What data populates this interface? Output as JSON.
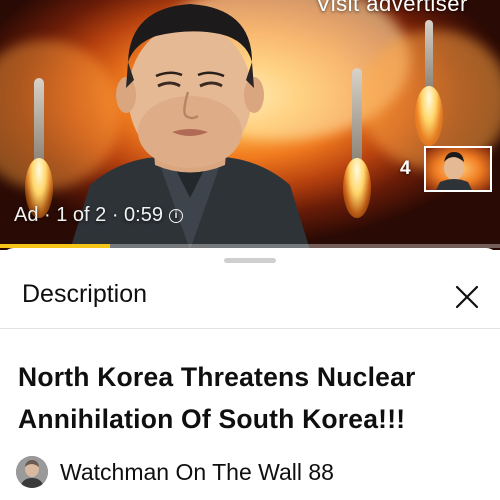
{
  "video": {
    "advertiser_link": "Visit advertiser",
    "ad_label": "Ad · 1 of 2 · 0:59",
    "info_icon": "info-icon",
    "up_next_count": "4",
    "progress_fraction": 0.22,
    "progress_color": "#f5c518"
  },
  "sheet": {
    "title": "Description",
    "close_icon": "close-icon"
  },
  "details": {
    "video_title": "North Korea Threatens Nuclear Annihilation Of South Korea!!!",
    "channel_name": "Watchman On The Wall 88"
  }
}
